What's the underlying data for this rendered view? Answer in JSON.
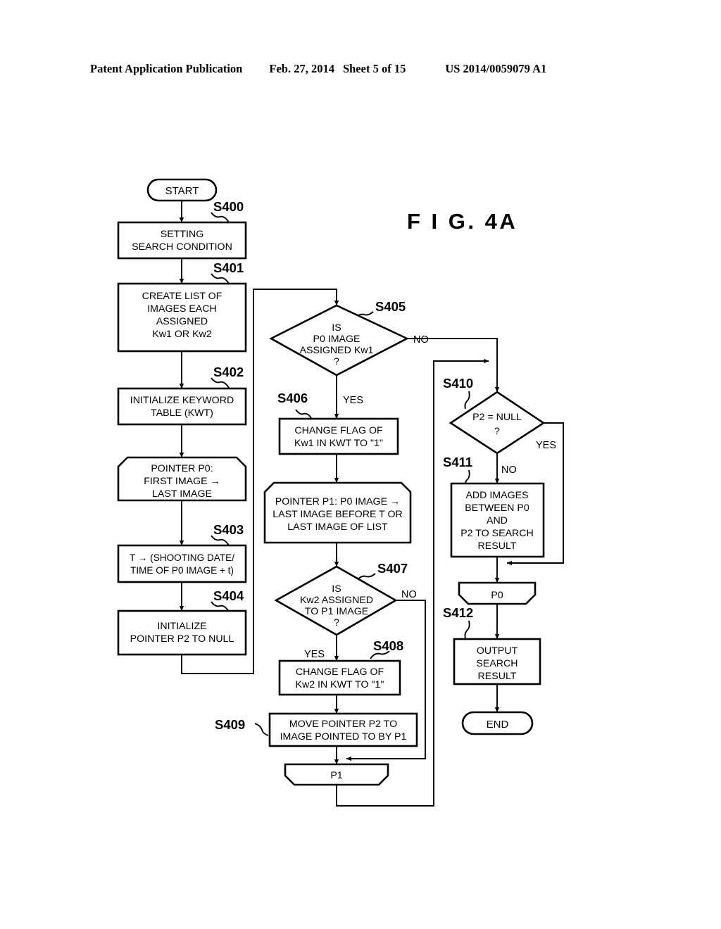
{
  "header": {
    "publication": "Patent Application Publication",
    "date": "Feb. 27, 2014",
    "sheet": "Sheet 5 of 15",
    "number": "US 2014/0059079 A1"
  },
  "figure": {
    "label": "F I G.  4A"
  },
  "flowchart": {
    "terminals": {
      "start": "START",
      "end": "END"
    },
    "nodes": [
      {
        "id": "S400",
        "step": "S400",
        "shape": "process",
        "lines": [
          "SETTING",
          "SEARCH CONDITION"
        ]
      },
      {
        "id": "S401",
        "step": "S401",
        "shape": "process",
        "lines": [
          "CREATE LIST OF",
          "IMAGES EACH",
          "ASSIGNED",
          "Kw1 OR Kw2"
        ]
      },
      {
        "id": "S402",
        "step": "S402",
        "shape": "process",
        "lines": [
          "INITIALIZE KEYWORD",
          "TABLE (KWT)"
        ]
      },
      {
        "id": "LOOP_P0_START",
        "step": "",
        "shape": "loop-start",
        "lines": [
          "POINTER P0:",
          "FIRST IMAGE →",
          "LAST IMAGE"
        ]
      },
      {
        "id": "S403",
        "step": "S403",
        "shape": "process",
        "lines": [
          "T → (SHOOTING DATE/",
          "TIME OF P0 IMAGE + t)"
        ]
      },
      {
        "id": "S404",
        "step": "S404",
        "shape": "process",
        "lines": [
          "INITIALIZE",
          "POINTER P2 TO NULL"
        ]
      },
      {
        "id": "S405",
        "step": "S405",
        "shape": "decision",
        "lines": [
          "IS",
          "P0 IMAGE",
          "ASSIGNED Kw1",
          "?"
        ],
        "yes": "YES",
        "no": "NO"
      },
      {
        "id": "S406",
        "step": "S406",
        "shape": "process",
        "lines": [
          "CHANGE FLAG OF",
          "Kw1 IN KWT TO \"1\""
        ]
      },
      {
        "id": "LOOP_P1_START",
        "step": "",
        "shape": "loop-start",
        "lines": [
          "POINTER P1: P0 IMAGE →",
          "LAST IMAGE BEFORE T OR",
          "LAST IMAGE OF LIST"
        ]
      },
      {
        "id": "S407",
        "step": "S407",
        "shape": "decision",
        "lines": [
          "IS",
          "Kw2 ASSIGNED",
          "TO P1 IMAGE",
          "?"
        ],
        "yes": "YES",
        "no": "NO"
      },
      {
        "id": "S408",
        "step": "S408",
        "shape": "process",
        "lines": [
          "CHANGE FLAG OF",
          "Kw2 IN KWT TO \"1\""
        ]
      },
      {
        "id": "S409",
        "step": "S409",
        "shape": "process",
        "lines": [
          "MOVE POINTER P2 TO",
          "IMAGE POINTED TO BY P1"
        ]
      },
      {
        "id": "LOOP_P1_END",
        "step": "",
        "shape": "loop-end",
        "lines": [
          "P1"
        ]
      },
      {
        "id": "S410",
        "step": "S410",
        "shape": "decision",
        "lines": [
          "P2 = NULL",
          "?"
        ],
        "yes": "YES",
        "no": "NO"
      },
      {
        "id": "S411",
        "step": "S411",
        "shape": "process",
        "lines": [
          "ADD IMAGES",
          "BETWEEN P0",
          "AND",
          "P2 TO SEARCH",
          "RESULT"
        ]
      },
      {
        "id": "LOOP_P0_END",
        "step": "",
        "shape": "loop-end",
        "lines": [
          "P0"
        ]
      },
      {
        "id": "S412",
        "step": "S412",
        "shape": "process",
        "lines": [
          "OUTPUT",
          "SEARCH",
          "RESULT"
        ]
      }
    ],
    "branch_labels": {
      "s405_no": "NO",
      "s405_yes": "YES",
      "s407_no": "NO",
      "s407_yes": "YES",
      "s410_yes": "YES",
      "s410_no": "NO"
    },
    "step_labels": {
      "s400": "S400",
      "s401": "S401",
      "s402": "S402",
      "s403": "S403",
      "s404": "S404",
      "s405": "S405",
      "s406": "S406",
      "s407": "S407",
      "s408": "S408",
      "s409": "S409",
      "s410": "S410",
      "s411": "S411",
      "s412": "S412"
    },
    "loop_text": {
      "p0_start_l1": "POINTER P0:",
      "p0_start_l2": "FIRST IMAGE →",
      "p0_start_l3": "LAST IMAGE",
      "p1_start_l1": "POINTER P1: P0 IMAGE →",
      "p1_start_l2": "LAST IMAGE BEFORE T OR",
      "p1_start_l3": "LAST IMAGE OF LIST",
      "p1_end": "P1",
      "p0_end": "P0"
    },
    "box_text": {
      "s400_l1": "SETTING",
      "s400_l2": "SEARCH CONDITION",
      "s401_l1": "CREATE LIST OF",
      "s401_l2": "IMAGES EACH",
      "s401_l3": "ASSIGNED",
      "s401_l4": "Kw1 OR Kw2",
      "s402_l1": "INITIALIZE KEYWORD",
      "s402_l2": "TABLE (KWT)",
      "s403_l1": "T → (SHOOTING DATE/",
      "s403_l2": "TIME OF P0 IMAGE + t)",
      "s404_l1": "INITIALIZE",
      "s404_l2": "POINTER P2 TO NULL",
      "s405_l1": "IS",
      "s405_l2": "P0 IMAGE",
      "s405_l3": "ASSIGNED Kw1",
      "s405_l4": "?",
      "s406_l1": "CHANGE FLAG OF",
      "s406_l2": "Kw1 IN KWT TO \"1\"",
      "s407_l1": "IS",
      "s407_l2": "Kw2 ASSIGNED",
      "s407_l3": "TO P1 IMAGE",
      "s407_l4": "?",
      "s408_l1": "CHANGE FLAG OF",
      "s408_l2": "Kw2 IN KWT TO \"1\"",
      "s409_l1": "MOVE POINTER P2 TO",
      "s409_l2": "IMAGE POINTED TO BY P1",
      "s410_l1": "P2 = NULL",
      "s410_l2": "?",
      "s411_l1": "ADD IMAGES",
      "s411_l2": "BETWEEN P0",
      "s411_l3": "AND",
      "s411_l4": "P2 TO SEARCH",
      "s411_l5": "RESULT",
      "s412_l1": "OUTPUT",
      "s412_l2": "SEARCH",
      "s412_l3": "RESULT",
      "start": "START",
      "end": "END"
    },
    "colors": {
      "line": "#000000",
      "fill": "#ffffff"
    }
  }
}
